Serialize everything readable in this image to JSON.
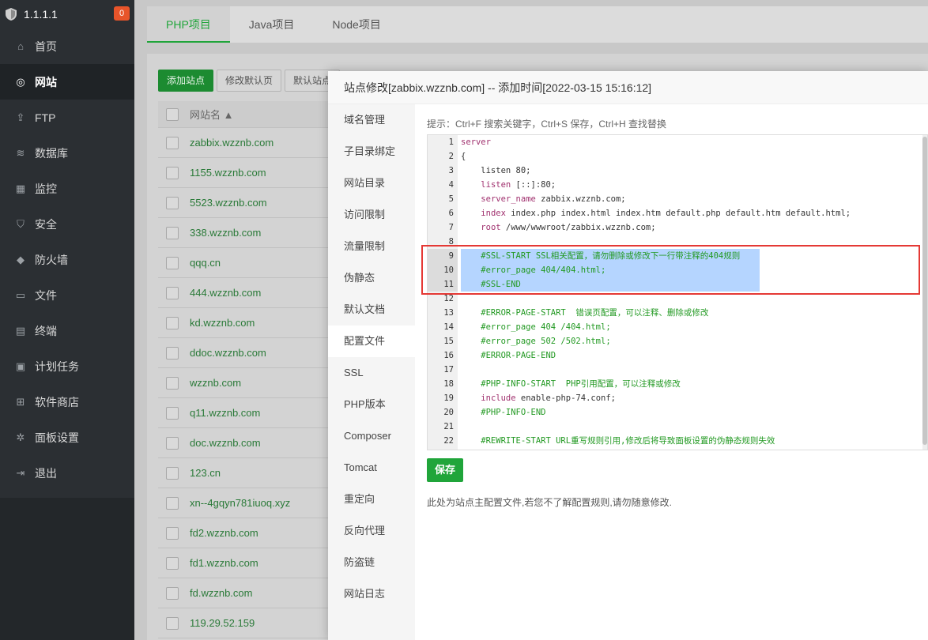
{
  "app": {
    "version": "1.1.1.1",
    "badge": "0"
  },
  "sidebar": {
    "items": [
      {
        "label": "首页",
        "icon": "home-icon",
        "glyph": "⌂"
      },
      {
        "label": "网站",
        "icon": "globe-icon",
        "glyph": "◎",
        "active": true
      },
      {
        "label": "FTP",
        "icon": "ftp-icon",
        "glyph": "⇪"
      },
      {
        "label": "数据库",
        "icon": "database-icon",
        "glyph": "≋"
      },
      {
        "label": "监控",
        "icon": "monitor-icon",
        "glyph": "▦"
      },
      {
        "label": "安全",
        "icon": "shield-icon",
        "glyph": "⛉"
      },
      {
        "label": "防火墙",
        "icon": "firewall-icon",
        "glyph": "◆"
      },
      {
        "label": "文件",
        "icon": "folder-icon",
        "glyph": "▭"
      },
      {
        "label": "终端",
        "icon": "terminal-icon",
        "glyph": "▤"
      },
      {
        "label": "计划任务",
        "icon": "calendar-icon",
        "glyph": "▣"
      },
      {
        "label": "软件商店",
        "icon": "apps-icon",
        "glyph": "⊞"
      },
      {
        "label": "面板设置",
        "icon": "gear-icon",
        "glyph": "✲"
      },
      {
        "label": "退出",
        "icon": "logout-icon",
        "glyph": "⇥"
      }
    ]
  },
  "main": {
    "tabs": [
      {
        "label": "PHP项目",
        "active": true
      },
      {
        "label": "Java项目"
      },
      {
        "label": "Node项目"
      }
    ],
    "toolbar": {
      "add_site": "添加站点",
      "edit_default": "修改默认页",
      "default_site": "默认站点"
    },
    "table": {
      "header": "网站名 ▲",
      "rows": [
        "zabbix.wzznb.com",
        "1155.wzznb.com",
        "5523.wzznb.com",
        "338.wzznb.com",
        "qqq.cn",
        "444.wzznb.com",
        "kd.wzznb.com",
        "ddoc.wzznb.com",
        "wzznb.com",
        "q11.wzznb.com",
        "doc.wzznb.com",
        "123.cn",
        "xn--4gqyn781iuoq.xyz",
        "fd2.wzznb.com",
        "fd1.wzznb.com",
        "fd.wzznb.com",
        "119.29.52.159"
      ]
    }
  },
  "modal": {
    "title": "站点修改[zabbix.wzznb.com] -- 添加时间[2022-03-15 15:16:12]",
    "nav": [
      "域名管理",
      "子目录绑定",
      "网站目录",
      "访问限制",
      "流量限制",
      "伪静态",
      "默认文档",
      "配置文件",
      "SSL",
      "PHP版本",
      "Composer",
      "Tomcat",
      "重定向",
      "反向代理",
      "防盗链",
      "网站日志"
    ],
    "active_nav": "配置文件",
    "hint": "提示：Ctrl+F 搜索关键字，Ctrl+S 保存，Ctrl+H 查找替换",
    "save_label": "保存",
    "note": "此处为站点主配置文件,若您不了解配置规则,请勿随意修改.",
    "code_lines": [
      {
        "n": "1",
        "text": "server",
        "kind": "kw"
      },
      {
        "n": "2",
        "text": "{",
        "kind": "plain"
      },
      {
        "n": "3",
        "text": "    listen 80;",
        "kind": "plain"
      },
      {
        "n": "4",
        "text": "    listen [::]:80;",
        "kind": "mixed",
        "kw": "listen",
        "rest": " [::]:80;"
      },
      {
        "n": "5",
        "text": "    server_name zabbix.wzznb.com;",
        "kind": "mixed",
        "kw": "server_name",
        "rest": " zabbix.wzznb.com;"
      },
      {
        "n": "6",
        "text": "    index index.php index.html index.htm default.php default.htm default.html;",
        "kind": "mixed",
        "kw": "index",
        "rest": " index.php index.html index.htm default.php default.htm default.html;"
      },
      {
        "n": "7",
        "text": "    root /www/wwwroot/zabbix.wzznb.com;",
        "kind": "mixed",
        "kw": "root",
        "rest": " /www/wwwroot/zabbix.wzznb.com;"
      },
      {
        "n": "8",
        "text": "",
        "kind": "plain"
      },
      {
        "n": "9",
        "text": "    #SSL-START SSL相关配置，请勿删除或修改下一行带注释的404规则",
        "kind": "cm",
        "sel": true
      },
      {
        "n": "10",
        "text": "    #error_page 404/404.html;",
        "kind": "cm",
        "sel": true
      },
      {
        "n": "11",
        "text": "    #SSL-END",
        "kind": "cm",
        "sel": true
      },
      {
        "n": "12",
        "text": "",
        "kind": "plain"
      },
      {
        "n": "13",
        "text": "    #ERROR-PAGE-START  错误页配置，可以注释、删除或修改",
        "kind": "cm"
      },
      {
        "n": "14",
        "text": "    #error_page 404 /404.html;",
        "kind": "cm"
      },
      {
        "n": "15",
        "text": "    #error_page 502 /502.html;",
        "kind": "cm"
      },
      {
        "n": "16",
        "text": "    #ERROR-PAGE-END",
        "kind": "cm"
      },
      {
        "n": "17",
        "text": "",
        "kind": "plain"
      },
      {
        "n": "18",
        "text": "    #PHP-INFO-START  PHP引用配置，可以注释或修改",
        "kind": "cm"
      },
      {
        "n": "19",
        "text": "    include enable-php-74.conf;",
        "kind": "mixed",
        "kw": "include",
        "rest": " enable-php-74.conf;"
      },
      {
        "n": "20",
        "text": "    #PHP-INFO-END",
        "kind": "cm"
      },
      {
        "n": "21",
        "text": "",
        "kind": "plain"
      },
      {
        "n": "22",
        "text": "    #REWRITE-START URL重写规则引用,修改后将导致面板设置的伪静态规则失效",
        "kind": "cm"
      }
    ]
  }
}
